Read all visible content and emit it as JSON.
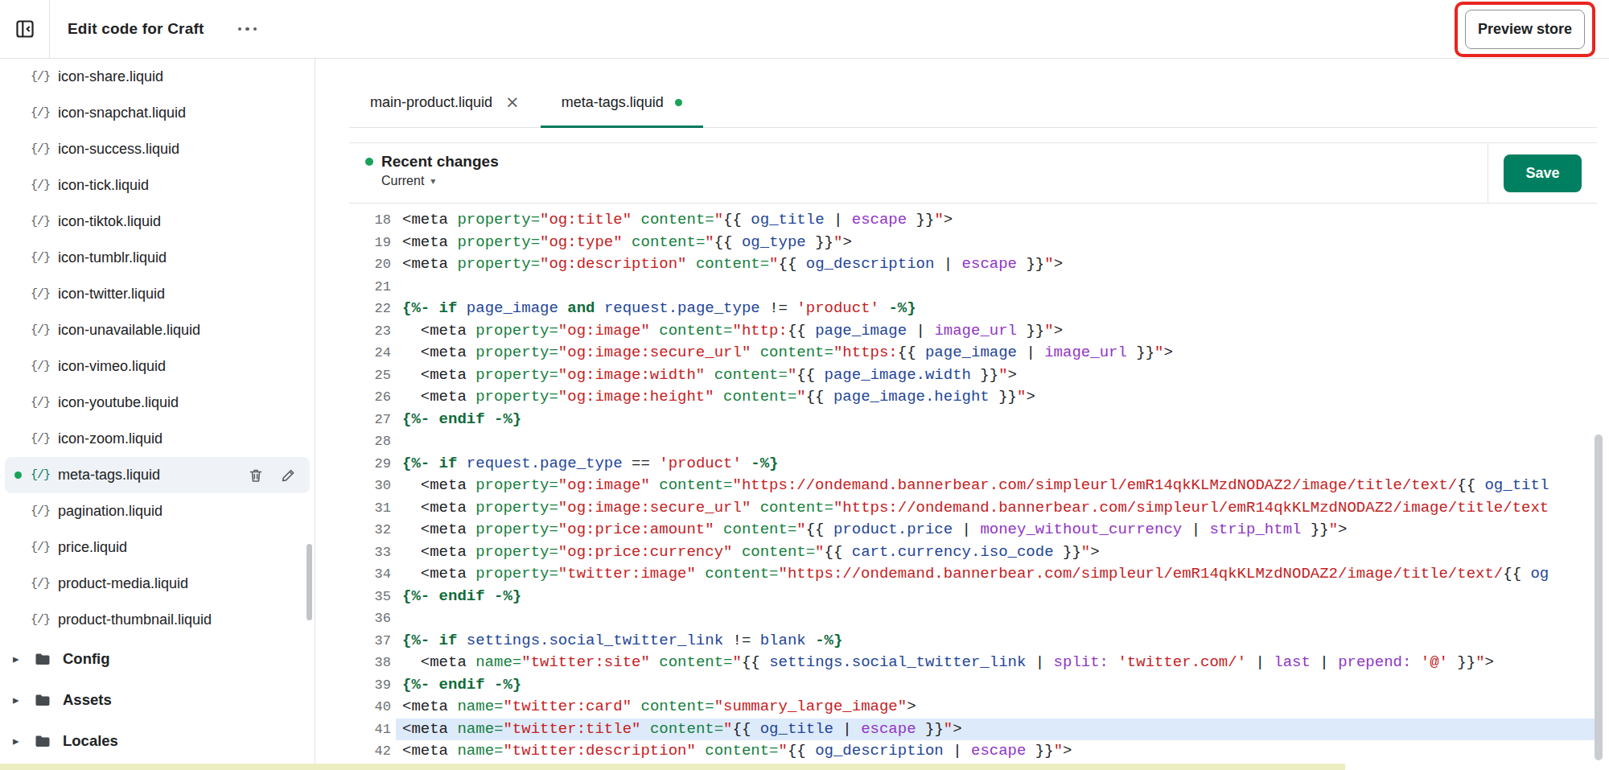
{
  "header": {
    "title": "Edit code for Craft",
    "preview_button_label": "Preview store"
  },
  "icons": {
    "file_glyph": "{/}",
    "close_glyph": "×",
    "caret_down": "▾",
    "chevron_right": "▸"
  },
  "colors": {
    "save_green": "#008060",
    "modified_dot_green": "#18a357",
    "active_tab_underline": "#007a5c",
    "annotation_red": "#e8251f",
    "line_highlight_blue": "#ddeafa"
  },
  "sidebar": {
    "files": [
      {
        "label": "icon-share.liquid"
      },
      {
        "label": "icon-snapchat.liquid"
      },
      {
        "label": "icon-success.liquid"
      },
      {
        "label": "icon-tick.liquid"
      },
      {
        "label": "icon-tiktok.liquid"
      },
      {
        "label": "icon-tumblr.liquid"
      },
      {
        "label": "icon-twitter.liquid"
      },
      {
        "label": "icon-unavailable.liquid"
      },
      {
        "label": "icon-vimeo.liquid"
      },
      {
        "label": "icon-youtube.liquid"
      },
      {
        "label": "icon-zoom.liquid"
      },
      {
        "label": "meta-tags.liquid",
        "selected": true,
        "modified": true
      },
      {
        "label": "pagination.liquid"
      },
      {
        "label": "price.liquid"
      },
      {
        "label": "product-media.liquid"
      },
      {
        "label": "product-thumbnail.liquid"
      }
    ],
    "folders": [
      {
        "label": "Config"
      },
      {
        "label": "Assets"
      },
      {
        "label": "Locales"
      }
    ]
  },
  "tabs": [
    {
      "label": "main-product.liquid",
      "active": false,
      "closable": true
    },
    {
      "label": "meta-tags.liquid",
      "active": true,
      "modified": true
    }
  ],
  "changes_bar": {
    "title": "Recent changes",
    "version_label": "Current",
    "save_label": "Save"
  },
  "editor": {
    "lines": [
      {
        "n": 18,
        "tk": [
          [
            "t",
            "<meta "
          ],
          [
            "a",
            "property="
          ],
          [
            "s",
            "\"og:title\""
          ],
          [
            "t",
            " "
          ],
          [
            "a",
            "content="
          ],
          [
            "s",
            "\""
          ],
          [
            "t",
            "{{ "
          ],
          [
            "v",
            "og_title"
          ],
          [
            "t",
            " | "
          ],
          [
            "f",
            "escape"
          ],
          [
            "t",
            " }}"
          ],
          [
            "s",
            "\""
          ],
          [
            "t",
            ">"
          ]
        ]
      },
      {
        "n": 19,
        "tk": [
          [
            "t",
            "<meta "
          ],
          [
            "a",
            "property="
          ],
          [
            "s",
            "\"og:type\""
          ],
          [
            "t",
            " "
          ],
          [
            "a",
            "content="
          ],
          [
            "s",
            "\""
          ],
          [
            "t",
            "{{ "
          ],
          [
            "v",
            "og_type"
          ],
          [
            "t",
            " }}"
          ],
          [
            "s",
            "\""
          ],
          [
            "t",
            ">"
          ]
        ]
      },
      {
        "n": 20,
        "tk": [
          [
            "t",
            "<meta "
          ],
          [
            "a",
            "property="
          ],
          [
            "s",
            "\"og:description\""
          ],
          [
            "t",
            " "
          ],
          [
            "a",
            "content="
          ],
          [
            "s",
            "\""
          ],
          [
            "t",
            "{{ "
          ],
          [
            "v",
            "og_description"
          ],
          [
            "t",
            " | "
          ],
          [
            "f",
            "escape"
          ],
          [
            "t",
            " }}"
          ],
          [
            "s",
            "\""
          ],
          [
            "t",
            ">"
          ]
        ]
      },
      {
        "n": 21,
        "tk": []
      },
      {
        "n": 22,
        "tk": [
          [
            "k",
            "{%- if"
          ],
          [
            "t",
            " "
          ],
          [
            "v",
            "page_image"
          ],
          [
            "t",
            " "
          ],
          [
            "k",
            "and"
          ],
          [
            "t",
            " "
          ],
          [
            "v",
            "request.page_type"
          ],
          [
            "t",
            " != "
          ],
          [
            "s",
            "'product'"
          ],
          [
            "t",
            " "
          ],
          [
            "k",
            "-%}"
          ]
        ]
      },
      {
        "n": 23,
        "tk": [
          [
            "t",
            "  <meta "
          ],
          [
            "a",
            "property="
          ],
          [
            "s",
            "\"og:image\""
          ],
          [
            "t",
            " "
          ],
          [
            "a",
            "content="
          ],
          [
            "s",
            "\"http:"
          ],
          [
            "t",
            "{{ "
          ],
          [
            "v",
            "page_image"
          ],
          [
            "t",
            " | "
          ],
          [
            "f",
            "image_url"
          ],
          [
            "t",
            " }}"
          ],
          [
            "s",
            "\""
          ],
          [
            "t",
            ">"
          ]
        ]
      },
      {
        "n": 24,
        "tk": [
          [
            "t",
            "  <meta "
          ],
          [
            "a",
            "property="
          ],
          [
            "s",
            "\"og:image:secure_url\""
          ],
          [
            "t",
            " "
          ],
          [
            "a",
            "content="
          ],
          [
            "s",
            "\"https:"
          ],
          [
            "t",
            "{{ "
          ],
          [
            "v",
            "page_image"
          ],
          [
            "t",
            " | "
          ],
          [
            "f",
            "image_url"
          ],
          [
            "t",
            " }}"
          ],
          [
            "s",
            "\""
          ],
          [
            "t",
            ">"
          ]
        ]
      },
      {
        "n": 25,
        "tk": [
          [
            "t",
            "  <meta "
          ],
          [
            "a",
            "property="
          ],
          [
            "s",
            "\"og:image:width\""
          ],
          [
            "t",
            " "
          ],
          [
            "a",
            "content="
          ],
          [
            "s",
            "\""
          ],
          [
            "t",
            "{{ "
          ],
          [
            "v",
            "page_image.width"
          ],
          [
            "t",
            " }}"
          ],
          [
            "s",
            "\""
          ],
          [
            "t",
            ">"
          ]
        ]
      },
      {
        "n": 26,
        "tk": [
          [
            "t",
            "  <meta "
          ],
          [
            "a",
            "property="
          ],
          [
            "s",
            "\"og:image:height\""
          ],
          [
            "t",
            " "
          ],
          [
            "a",
            "content="
          ],
          [
            "s",
            "\""
          ],
          [
            "t",
            "{{ "
          ],
          [
            "v",
            "page_image.height"
          ],
          [
            "t",
            " }}"
          ],
          [
            "s",
            "\""
          ],
          [
            "t",
            ">"
          ]
        ]
      },
      {
        "n": 27,
        "tk": [
          [
            "k",
            "{%- endif -%}"
          ]
        ]
      },
      {
        "n": 28,
        "tk": []
      },
      {
        "n": 29,
        "tk": [
          [
            "k",
            "{%- if"
          ],
          [
            "t",
            " "
          ],
          [
            "v",
            "request.page_type"
          ],
          [
            "t",
            " == "
          ],
          [
            "s",
            "'product'"
          ],
          [
            "t",
            " "
          ],
          [
            "k",
            "-%}"
          ]
        ]
      },
      {
        "n": 30,
        "tk": [
          [
            "t",
            "  <meta "
          ],
          [
            "a",
            "property="
          ],
          [
            "s",
            "\"og:image\""
          ],
          [
            "t",
            " "
          ],
          [
            "a",
            "content="
          ],
          [
            "s",
            "\"https://ondemand.bannerbear.com/simpleurl/emR14qkKLMzdNODAZ2/image/title/text/"
          ],
          [
            "t",
            "{{ "
          ],
          [
            "v",
            "og_titl"
          ]
        ]
      },
      {
        "n": 31,
        "tk": [
          [
            "t",
            "  <meta "
          ],
          [
            "a",
            "property="
          ],
          [
            "s",
            "\"og:image:secure_url\""
          ],
          [
            "t",
            " "
          ],
          [
            "a",
            "content="
          ],
          [
            "s",
            "\"https://ondemand.bannerbear.com/simpleurl/emR14qkKLMzdNODAZ2/image/title/text"
          ]
        ]
      },
      {
        "n": 32,
        "tk": [
          [
            "t",
            "  <meta "
          ],
          [
            "a",
            "property="
          ],
          [
            "s",
            "\"og:price:amount\""
          ],
          [
            "t",
            " "
          ],
          [
            "a",
            "content="
          ],
          [
            "s",
            "\""
          ],
          [
            "t",
            "{{ "
          ],
          [
            "v",
            "product.price"
          ],
          [
            "t",
            " | "
          ],
          [
            "f",
            "money_without_currency"
          ],
          [
            "t",
            " | "
          ],
          [
            "f",
            "strip_html"
          ],
          [
            "t",
            " }}"
          ],
          [
            "s",
            "\""
          ],
          [
            "t",
            ">"
          ]
        ]
      },
      {
        "n": 33,
        "tk": [
          [
            "t",
            "  <meta "
          ],
          [
            "a",
            "property="
          ],
          [
            "s",
            "\"og:price:currency\""
          ],
          [
            "t",
            " "
          ],
          [
            "a",
            "content="
          ],
          [
            "s",
            "\""
          ],
          [
            "t",
            "{{ "
          ],
          [
            "v",
            "cart.currency.iso_code"
          ],
          [
            "t",
            " }}"
          ],
          [
            "s",
            "\""
          ],
          [
            "t",
            ">"
          ]
        ]
      },
      {
        "n": 34,
        "tk": [
          [
            "t",
            "  <meta "
          ],
          [
            "a",
            "property="
          ],
          [
            "s",
            "\"twitter:image\""
          ],
          [
            "t",
            " "
          ],
          [
            "a",
            "content="
          ],
          [
            "s",
            "\"https://ondemand.bannerbear.com/simpleurl/emR14qkKLMzdNODAZ2/image/title/text/"
          ],
          [
            "t",
            "{{ "
          ],
          [
            "v",
            "og"
          ]
        ]
      },
      {
        "n": 35,
        "tk": [
          [
            "k",
            "{%- endif -%}"
          ]
        ]
      },
      {
        "n": 36,
        "tk": []
      },
      {
        "n": 37,
        "tk": [
          [
            "k",
            "{%- if"
          ],
          [
            "t",
            " "
          ],
          [
            "v",
            "settings.social_twitter_link"
          ],
          [
            "t",
            " != "
          ],
          [
            "v",
            "blank"
          ],
          [
            "t",
            " "
          ],
          [
            "k",
            "-%}"
          ]
        ]
      },
      {
        "n": 38,
        "tk": [
          [
            "t",
            "  <meta "
          ],
          [
            "a",
            "name="
          ],
          [
            "s",
            "\"twitter:site\""
          ],
          [
            "t",
            " "
          ],
          [
            "a",
            "content="
          ],
          [
            "s",
            "\""
          ],
          [
            "t",
            "{{ "
          ],
          [
            "v",
            "settings.social_twitter_link"
          ],
          [
            "t",
            " | "
          ],
          [
            "f",
            "split:"
          ],
          [
            "t",
            " "
          ],
          [
            "s",
            "'twitter.com/'"
          ],
          [
            "t",
            " | "
          ],
          [
            "f",
            "last"
          ],
          [
            "t",
            " | "
          ],
          [
            "f",
            "prepend:"
          ],
          [
            "t",
            " "
          ],
          [
            "s",
            "'@'"
          ],
          [
            "t",
            " }}"
          ],
          [
            "s",
            "\""
          ],
          [
            "t",
            ">"
          ]
        ]
      },
      {
        "n": 39,
        "tk": [
          [
            "k",
            "{%- endif -%}"
          ]
        ]
      },
      {
        "n": 40,
        "tk": [
          [
            "t",
            "<meta "
          ],
          [
            "a",
            "name="
          ],
          [
            "s",
            "\"twitter:card\""
          ],
          [
            "t",
            " "
          ],
          [
            "a",
            "content="
          ],
          [
            "s",
            "\"summary_large_image\""
          ],
          [
            "t",
            ">"
          ]
        ]
      },
      {
        "n": 41,
        "hl": true,
        "tk": [
          [
            "t",
            "<meta "
          ],
          [
            "a",
            "name="
          ],
          [
            "s",
            "\"twitter:title\""
          ],
          [
            "t",
            " "
          ],
          [
            "a",
            "content="
          ],
          [
            "s",
            "\""
          ],
          [
            "t",
            "{{ "
          ],
          [
            "v",
            "og_title"
          ],
          [
            "t",
            " | "
          ],
          [
            "f",
            "escape"
          ],
          [
            "t",
            " }}"
          ],
          [
            "s",
            "\""
          ],
          [
            "t",
            ">"
          ]
        ]
      },
      {
        "n": 42,
        "tk": [
          [
            "t",
            "<meta "
          ],
          [
            "a",
            "name="
          ],
          [
            "s",
            "\"twitter:description\""
          ],
          [
            "t",
            " "
          ],
          [
            "a",
            "content="
          ],
          [
            "s",
            "\""
          ],
          [
            "t",
            "{{ "
          ],
          [
            "v",
            "og_description"
          ],
          [
            "t",
            " | "
          ],
          [
            "f",
            "escape"
          ],
          [
            "t",
            " }}"
          ],
          [
            "s",
            "\""
          ],
          [
            "t",
            ">"
          ]
        ]
      }
    ]
  }
}
